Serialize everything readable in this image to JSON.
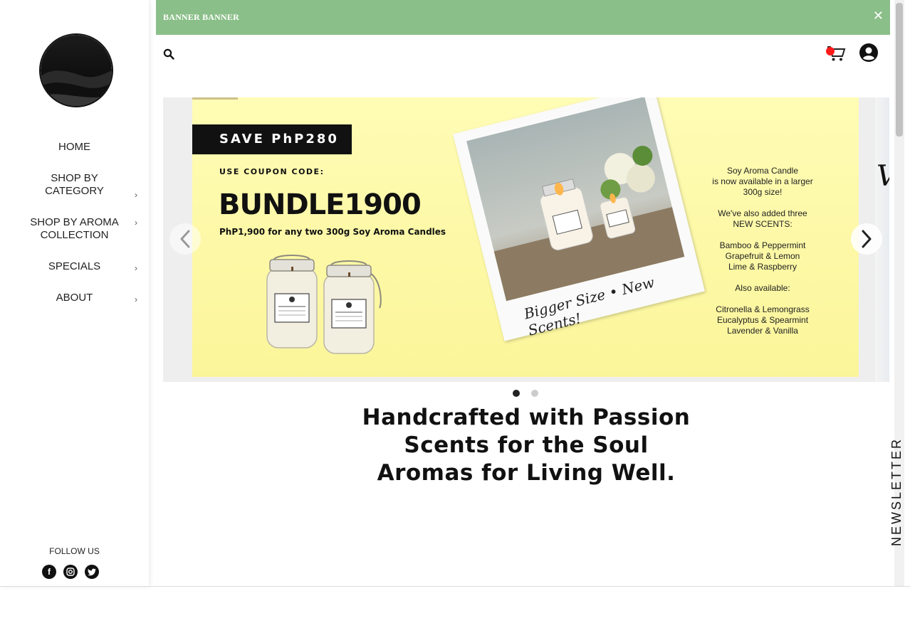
{
  "banner": {
    "text": "BANNER BANNER",
    "close_icon": "close-icon",
    "color": "#8bbf89"
  },
  "header": {
    "search_icon": "search-icon",
    "cart_icon": "cart-icon",
    "account_icon": "account-icon",
    "cart_badge_color": "#ff1a1a"
  },
  "sidebar": {
    "logo_icon": "logo",
    "items": [
      {
        "label": "HOME",
        "has_submenu": false
      },
      {
        "label": "SHOP BY CATEGORY",
        "has_submenu": true
      },
      {
        "label": "SHOP BY AROMA COLLECTION",
        "has_submenu": true
      },
      {
        "label": "SPECIALS",
        "has_submenu": true
      },
      {
        "label": "ABOUT",
        "has_submenu": true
      }
    ],
    "submenu_glyph": "›",
    "follow_label": "FOLLOW US",
    "social": [
      "facebook-icon",
      "instagram-icon",
      "twitter-icon"
    ]
  },
  "slider": {
    "save_tag": "SAVE PhP280",
    "coupon_label": "USE COUPON CODE:",
    "coupon_code": "BUNDLE1900",
    "coupon_desc": "PhP1,900 for any two 300g Soy Aroma Candles",
    "polaroid_caption": "Bigger Size • New Scents!",
    "copy": {
      "p1": [
        "Soy Aroma Candle",
        "is now available in a larger",
        "300g size!"
      ],
      "p2": [
        "We've also added three",
        "NEW SCENTS:"
      ],
      "p3": [
        "Bamboo & Peppermint",
        "Grapefruit & Lemon",
        "Lime & Raspberry"
      ],
      "p4": [
        "Also available:"
      ],
      "p5": [
        "Citronella & Lemongrass",
        "Eucalyptus & Spearmint",
        "Lavender & Vanilla"
      ]
    },
    "peek_text": "V",
    "active_slide": 1,
    "slide_count": 2,
    "slide_background": "#fdf9a8"
  },
  "tagline": [
    "Handcrafted with Passion",
    "Scents for the Soul",
    "Aromas for Living Well."
  ],
  "newsletter": {
    "label": "NEWSLETTER"
  }
}
